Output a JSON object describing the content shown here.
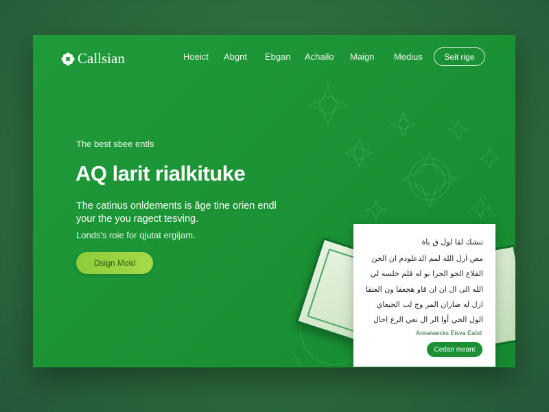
{
  "brand": {
    "name": "Callsian",
    "icon": "flower-icon"
  },
  "nav": {
    "items": [
      "Hoeict",
      "Abgnt",
      "Ebgan",
      "Achailo",
      "Maign",
      "Medius"
    ],
    "cta": "Seit rige"
  },
  "hero": {
    "eyebrow": "The best sbee entls",
    "headline": "AQ larit rialkituke",
    "body": "The catinus onldements is ăge tine orien endl your the you ragect tesving.",
    "subline": "Londs's roie for qjutat ergijam.",
    "cta": "Dsign Mold"
  },
  "panel": {
    "lines": [
      "ننشك لقا لول ق باة",
      "مص ارل اللة لمم الدعلودم ان الجن",
      "الفلاع الجو الجرا نو له قلم خلسه لي",
      "الله الى ال ان ان قاو هجعفا ون العتقا",
      "ازل له ضاران المر وج لب الجيعاي",
      "الول الحي أوا الر ال تعي الرغ احال"
    ],
    "caption": "Annaiwecks Eisva Eabd",
    "button": "Cedan meant"
  },
  "colors": {
    "background": "#2f7040",
    "card": "#1c9436",
    "cta": "#a6d94a",
    "panel_button": "#1d8f35"
  }
}
